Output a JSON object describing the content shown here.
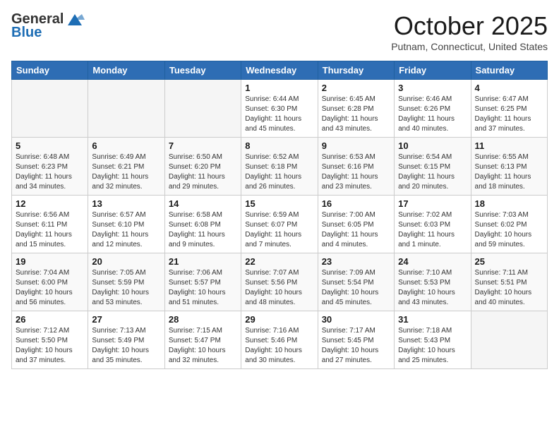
{
  "header": {
    "logo_general": "General",
    "logo_blue": "Blue",
    "month_title": "October 2025",
    "location": "Putnam, Connecticut, United States"
  },
  "days_of_week": [
    "Sunday",
    "Monday",
    "Tuesday",
    "Wednesday",
    "Thursday",
    "Friday",
    "Saturday"
  ],
  "weeks": [
    [
      {
        "day": "",
        "info": ""
      },
      {
        "day": "",
        "info": ""
      },
      {
        "day": "",
        "info": ""
      },
      {
        "day": "1",
        "info": "Sunrise: 6:44 AM\nSunset: 6:30 PM\nDaylight: 11 hours\nand 45 minutes."
      },
      {
        "day": "2",
        "info": "Sunrise: 6:45 AM\nSunset: 6:28 PM\nDaylight: 11 hours\nand 43 minutes."
      },
      {
        "day": "3",
        "info": "Sunrise: 6:46 AM\nSunset: 6:26 PM\nDaylight: 11 hours\nand 40 minutes."
      },
      {
        "day": "4",
        "info": "Sunrise: 6:47 AM\nSunset: 6:25 PM\nDaylight: 11 hours\nand 37 minutes."
      }
    ],
    [
      {
        "day": "5",
        "info": "Sunrise: 6:48 AM\nSunset: 6:23 PM\nDaylight: 11 hours\nand 34 minutes."
      },
      {
        "day": "6",
        "info": "Sunrise: 6:49 AM\nSunset: 6:21 PM\nDaylight: 11 hours\nand 32 minutes."
      },
      {
        "day": "7",
        "info": "Sunrise: 6:50 AM\nSunset: 6:20 PM\nDaylight: 11 hours\nand 29 minutes."
      },
      {
        "day": "8",
        "info": "Sunrise: 6:52 AM\nSunset: 6:18 PM\nDaylight: 11 hours\nand 26 minutes."
      },
      {
        "day": "9",
        "info": "Sunrise: 6:53 AM\nSunset: 6:16 PM\nDaylight: 11 hours\nand 23 minutes."
      },
      {
        "day": "10",
        "info": "Sunrise: 6:54 AM\nSunset: 6:15 PM\nDaylight: 11 hours\nand 20 minutes."
      },
      {
        "day": "11",
        "info": "Sunrise: 6:55 AM\nSunset: 6:13 PM\nDaylight: 11 hours\nand 18 minutes."
      }
    ],
    [
      {
        "day": "12",
        "info": "Sunrise: 6:56 AM\nSunset: 6:11 PM\nDaylight: 11 hours\nand 15 minutes."
      },
      {
        "day": "13",
        "info": "Sunrise: 6:57 AM\nSunset: 6:10 PM\nDaylight: 11 hours\nand 12 minutes."
      },
      {
        "day": "14",
        "info": "Sunrise: 6:58 AM\nSunset: 6:08 PM\nDaylight: 11 hours\nand 9 minutes."
      },
      {
        "day": "15",
        "info": "Sunrise: 6:59 AM\nSunset: 6:07 PM\nDaylight: 11 hours\nand 7 minutes."
      },
      {
        "day": "16",
        "info": "Sunrise: 7:00 AM\nSunset: 6:05 PM\nDaylight: 11 hours\nand 4 minutes."
      },
      {
        "day": "17",
        "info": "Sunrise: 7:02 AM\nSunset: 6:03 PM\nDaylight: 11 hours\nand 1 minute."
      },
      {
        "day": "18",
        "info": "Sunrise: 7:03 AM\nSunset: 6:02 PM\nDaylight: 10 hours\nand 59 minutes."
      }
    ],
    [
      {
        "day": "19",
        "info": "Sunrise: 7:04 AM\nSunset: 6:00 PM\nDaylight: 10 hours\nand 56 minutes."
      },
      {
        "day": "20",
        "info": "Sunrise: 7:05 AM\nSunset: 5:59 PM\nDaylight: 10 hours\nand 53 minutes."
      },
      {
        "day": "21",
        "info": "Sunrise: 7:06 AM\nSunset: 5:57 PM\nDaylight: 10 hours\nand 51 minutes."
      },
      {
        "day": "22",
        "info": "Sunrise: 7:07 AM\nSunset: 5:56 PM\nDaylight: 10 hours\nand 48 minutes."
      },
      {
        "day": "23",
        "info": "Sunrise: 7:09 AM\nSunset: 5:54 PM\nDaylight: 10 hours\nand 45 minutes."
      },
      {
        "day": "24",
        "info": "Sunrise: 7:10 AM\nSunset: 5:53 PM\nDaylight: 10 hours\nand 43 minutes."
      },
      {
        "day": "25",
        "info": "Sunrise: 7:11 AM\nSunset: 5:51 PM\nDaylight: 10 hours\nand 40 minutes."
      }
    ],
    [
      {
        "day": "26",
        "info": "Sunrise: 7:12 AM\nSunset: 5:50 PM\nDaylight: 10 hours\nand 37 minutes."
      },
      {
        "day": "27",
        "info": "Sunrise: 7:13 AM\nSunset: 5:49 PM\nDaylight: 10 hours\nand 35 minutes."
      },
      {
        "day": "28",
        "info": "Sunrise: 7:15 AM\nSunset: 5:47 PM\nDaylight: 10 hours\nand 32 minutes."
      },
      {
        "day": "29",
        "info": "Sunrise: 7:16 AM\nSunset: 5:46 PM\nDaylight: 10 hours\nand 30 minutes."
      },
      {
        "day": "30",
        "info": "Sunrise: 7:17 AM\nSunset: 5:45 PM\nDaylight: 10 hours\nand 27 minutes."
      },
      {
        "day": "31",
        "info": "Sunrise: 7:18 AM\nSunset: 5:43 PM\nDaylight: 10 hours\nand 25 minutes."
      },
      {
        "day": "",
        "info": ""
      }
    ]
  ]
}
